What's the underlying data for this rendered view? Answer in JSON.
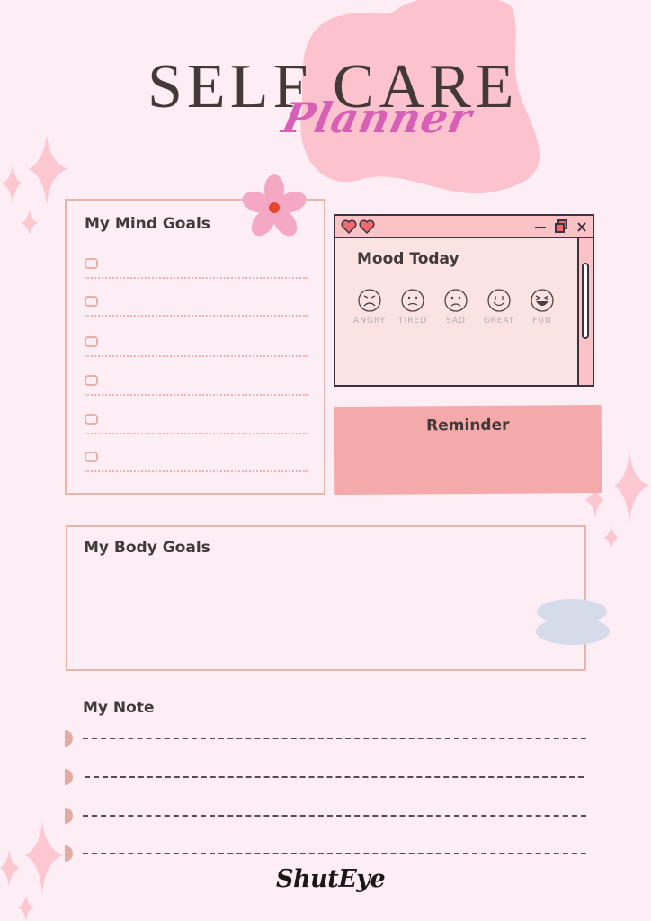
{
  "header": {
    "title": "SELF CARE",
    "subtitle": "Planner"
  },
  "mind_goals": {
    "heading": "My Mind Goals",
    "items": [
      "",
      "",
      "",
      "",
      "",
      ""
    ]
  },
  "mood": {
    "heading": "Mood Today",
    "window_controls": [
      "minimize-icon",
      "restore-icon",
      "close-icon"
    ],
    "close_label": "X",
    "faces": [
      {
        "label": "ANGRY",
        "icon": "angry-face-icon"
      },
      {
        "label": "TIRED",
        "icon": "tired-face-icon"
      },
      {
        "label": "SAD",
        "icon": "sad-face-icon"
      },
      {
        "label": "GREAT",
        "icon": "smile-face-icon"
      },
      {
        "label": "FUN",
        "icon": "laughing-face-icon"
      }
    ]
  },
  "reminder": {
    "heading": "Reminder"
  },
  "body_goals": {
    "heading": "My Body Goals"
  },
  "note": {
    "heading": "My Note",
    "lines": [
      "",
      "",
      "",
      ""
    ]
  },
  "brand": "ShutEye",
  "colors": {
    "background": "#fdedf4",
    "blob": "#fcc3cf",
    "accent_script": "#d75fb5",
    "panel_border": "#e9b3ad",
    "reminder_bg": "#f4a9aa",
    "mood_window_bg": "#fbe3e4",
    "mood_bar": "#fcc3c6",
    "heart": "#f0696d",
    "flower": "#f5a8c4",
    "flower_center": "#e8452e",
    "cloud": "#d6dbea"
  }
}
